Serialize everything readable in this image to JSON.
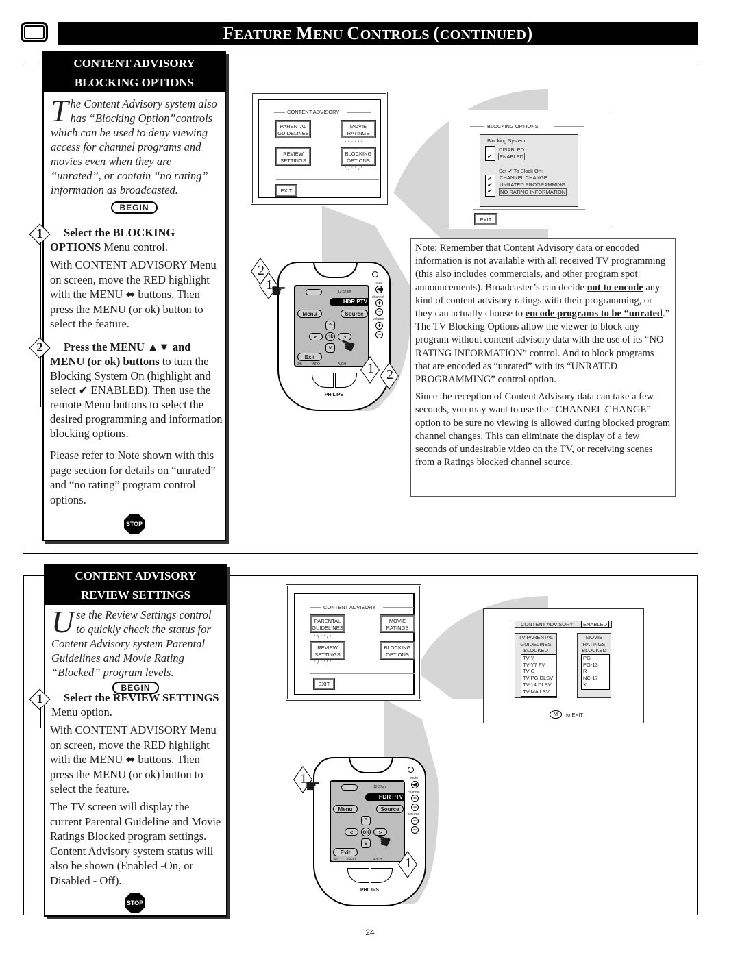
{
  "header": {
    "icon": "tv-icon",
    "title_parts": [
      {
        "big": "F",
        "small": "EATURE "
      },
      {
        "big": "M",
        "small": "ENU "
      },
      {
        "big": "C",
        "small": "ONTROLS "
      },
      {
        "big": "(",
        "small": "CONTINUED"
      },
      {
        "big": ")",
        "small": ""
      }
    ]
  },
  "section1": {
    "card": {
      "title_line1": "CONTENT ADVISORY",
      "title_line2": "BLOCKING OPTIONS",
      "intro_dropcap": "T",
      "intro_text": "he Content Advisory system also has “Blocking Option”controls which can be used to deny viewing access for channel programs and movies even when they are “unrated”, or contain “no rating” information as broadcasted.",
      "begin_label": "BEGIN",
      "steps": [
        {
          "number": "1",
          "heading_bold": "Select the BLOCKING OPTIONS",
          "heading_rest": " Menu control.",
          "body": "With CONTENT ADVISORY Menu on screen, move the RED highlight with the MENU ⬌ buttons. Then press the MENU (or ok) button to select the feature."
        },
        {
          "number": "2",
          "heading_bold": "Press the MENU ▲▼ and MENU (or ok) buttons",
          "heading_rest": " to turn the Blocking System On (highlight and select ✔ ENABLED). Then use the remote Menu buttons to select the desired programming and information blocking options.",
          "body": "Please refer to Note shown with this page section for details on “unrated” and “no rating” program control options."
        }
      ],
      "stop_label": "STOP"
    },
    "menu_screen": {
      "title": "CONTENT ADVISORY",
      "buttons": [
        "PARENTAL GUIDELINES",
        "MOVIE RATINGS",
        "REVIEW SETTINGS",
        "BLOCKING OPTIONS"
      ],
      "highlighted": "BLOCKING OPTIONS",
      "exit_label": "EXIT"
    },
    "blocking_screen": {
      "title": "BLOCKING OPTIONS",
      "system_label": "Blocking System:",
      "system_options": [
        {
          "label": "DISABLED",
          "checked": false
        },
        {
          "label": "ENABLED",
          "checked": true
        }
      ],
      "set_label": "Set ✔ To Block On:",
      "block_options": [
        {
          "label": "CHANNEL CHANGE",
          "checked": true
        },
        {
          "label": "UNRATED PROGRAMMING",
          "checked": true
        },
        {
          "label": "NO RATING INFORMATION",
          "checked": true
        }
      ],
      "exit_label": "EXIT"
    },
    "remote": {
      "time": "12:37pm",
      "device": "HDR PTV",
      "menu": "Menu",
      "source": "Source",
      "ok": "ok",
      "exit": "Exit",
      "bottom_left": "3/5",
      "info": "INFO",
      "bottom_right": "A/CH",
      "mute": "mute",
      "channel": "channel",
      "volume": "volume",
      "brand": "PHILIPS",
      "callouts": [
        "2",
        "1",
        "1",
        "2"
      ]
    },
    "note": {
      "p1_a": "Note: Remember that Content Advisory data or encoded information is not available with all received TV programming (this also includes commercials, and other program spot announcements). Broadcaster’s can decide ",
      "p1_b": "not to encode",
      "p1_c": " any kind of content advisory ratings with their programming, or they can actually choose to ",
      "p1_d": "encode programs to be “unrated",
      "p1_e": ".”",
      "p2": "The TV Blocking Options allow the viewer to block any program without content advisory data with the use of its “NO RATING INFORMATION” control. And to block programs that are encoded as “unrated” with its “UNRATED PROGRAMMING” control option.",
      "p3": "Since the reception of Content Advisory data can take a few seconds, you may want to use the “CHANNEL CHANGE” option to be sure no viewing is allowed during blocked program channel changes. This can eliminate the display of a few seconds of undesirable video on the TV, or receiving scenes from a Ratings blocked channel source."
    }
  },
  "section2": {
    "card": {
      "title_line1": "CONTENT ADVISORY",
      "title_line2": "REVIEW SETTINGS",
      "intro_dropcap": "U",
      "intro_text": "se the Review Settings control to quickly check the status for Content Advisory system Parental Guidelines and Movie Rating “Blocked” program levels.",
      "begin_label": "BEGIN",
      "steps": [
        {
          "number": "1",
          "heading_bold": "Select the REVIEW SETTINGS",
          "heading_rest": " Menu option.",
          "body": "With CONTENT ADVISORY Menu on screen, move the RED highlight with the MENU ⬌ buttons. Then press the MENU (or ok) button to select the feature.",
          "body2": "The TV screen will display the current Parental Guideline and Movie Ratings Blocked program settings. Content Advisory system status will also be shown (Enabled -On, or Disabled - Off)."
        }
      ],
      "stop_label": "STOP"
    },
    "menu_screen": {
      "title": "CONTENT ADVISORY",
      "buttons": [
        "PARENTAL GUIDELINES",
        "MOVIE RATINGS",
        "REVIEW SETTINGS",
        "BLOCKING OPTIONS"
      ],
      "highlighted": "REVIEW SETTINGS",
      "exit_label": "EXIT"
    },
    "review_screen": {
      "title": "CONTENT ADVISORY",
      "status": "ENABLED",
      "tv_header": [
        "TV PARENTAL",
        "GUIDELINES",
        "BLOCKED"
      ],
      "tv_items": [
        "TV-Y",
        "TV-Y7  FV",
        "TV-G",
        "TV-PG DLSV",
        "TV-14  DLSV",
        "TV-MA   LSV"
      ],
      "movie_header": [
        "MOVIE",
        "RATINGS",
        "BLOCKED"
      ],
      "movie_items": [
        "PG",
        "PG-13",
        "R",
        "NC-17",
        "X"
      ],
      "exit_key": "M",
      "exit_text": "to EXIT"
    },
    "remote": {
      "time": "12:37pm",
      "device": "HDR PTV",
      "menu": "Menu",
      "source": "Source",
      "ok": "ok",
      "exit": "Exit",
      "bottom_left": "3/5",
      "info": "INFO",
      "bottom_right": "A/CH",
      "mute": "mute",
      "channel": "channel",
      "volume": "volume",
      "brand": "PHILIPS",
      "callouts": [
        "1",
        "1"
      ]
    }
  },
  "page_number": "24"
}
